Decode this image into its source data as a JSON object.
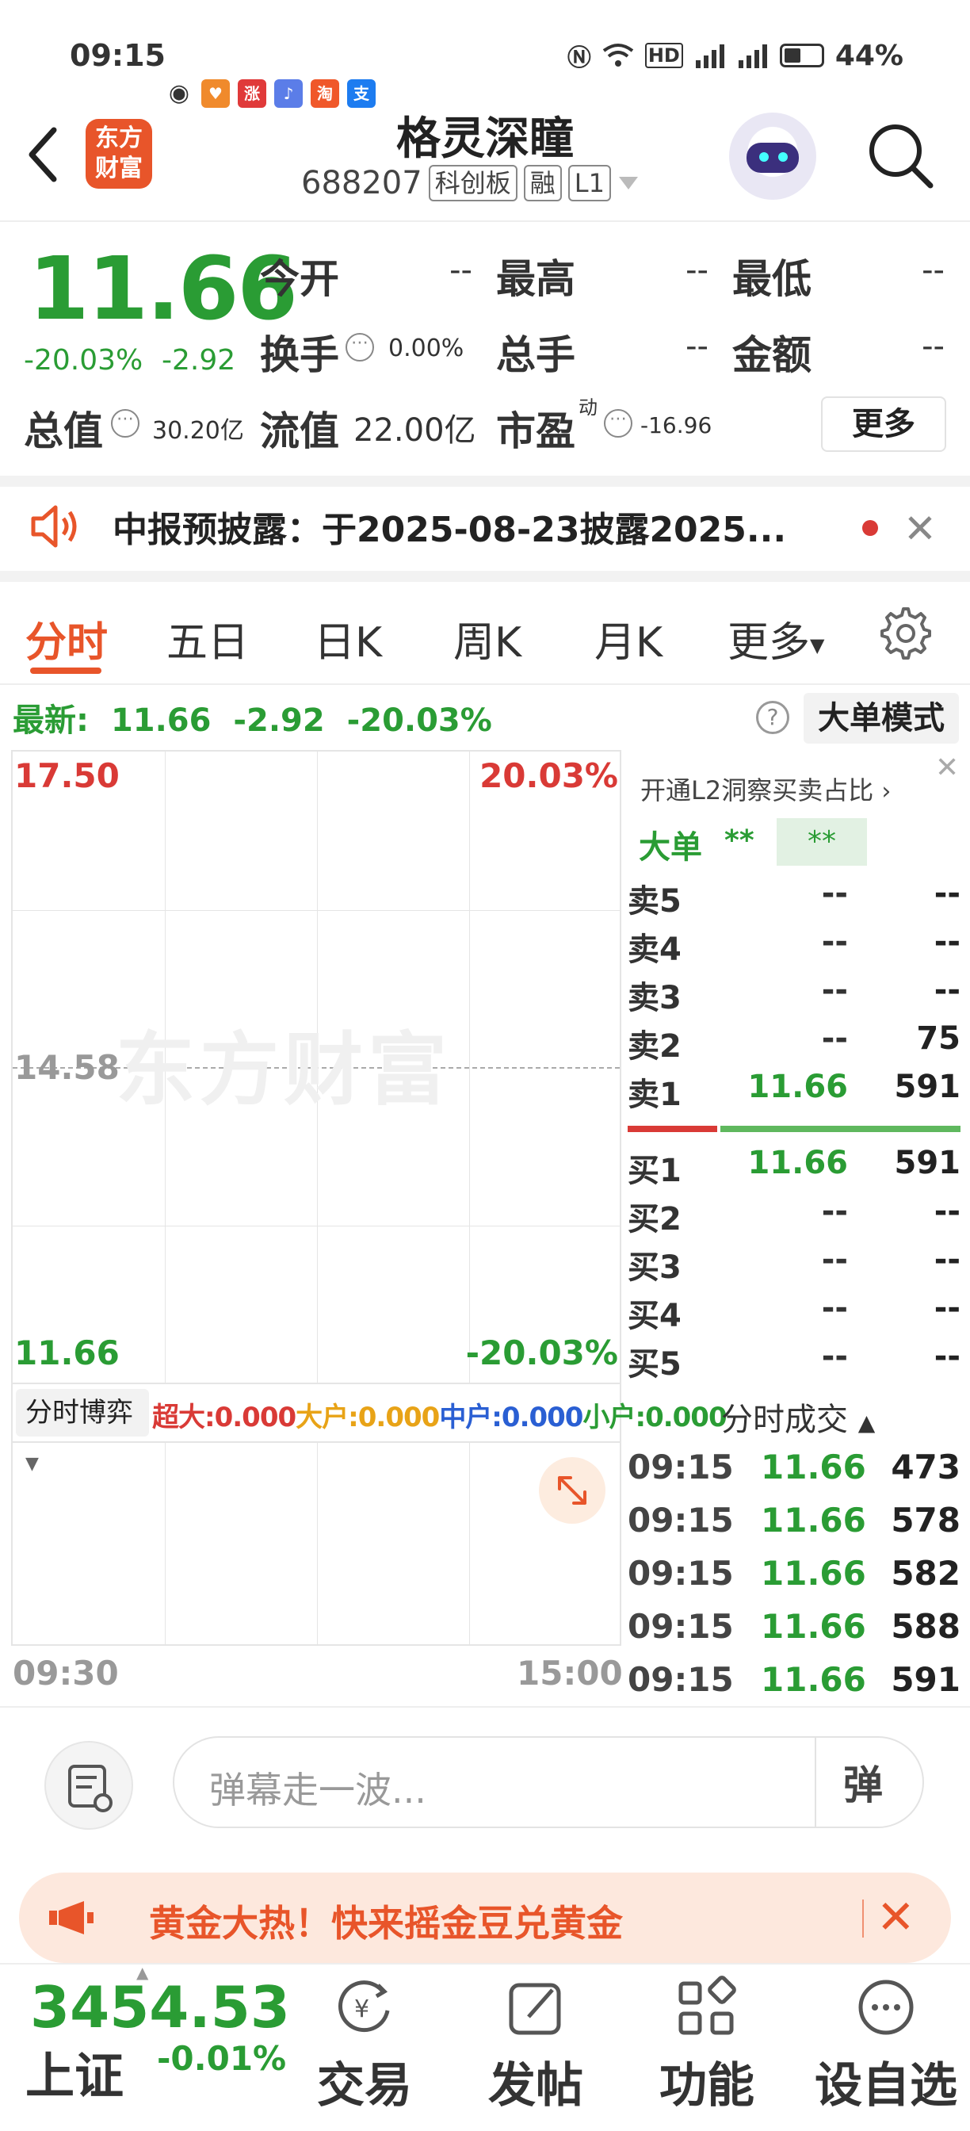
{
  "status_bar": {
    "time": "09:15",
    "battery": "44%",
    "apps": [
      {
        "name": "eye-icon",
        "color": "#333333",
        "glyph": "◉"
      },
      {
        "name": "taobao-heart-icon",
        "color": "#f08a2c",
        "glyph": "♥"
      },
      {
        "name": "zhang-app-icon",
        "color": "#e03a3a",
        "glyph": "涨"
      },
      {
        "name": "music-app-icon",
        "color": "#5b7de8",
        "glyph": "♪"
      },
      {
        "name": "taobao-app-icon",
        "color": "#f0582a",
        "glyph": "淘"
      },
      {
        "name": "alipay-app-icon",
        "color": "#1d7cf0",
        "glyph": "支"
      }
    ]
  },
  "header": {
    "logo_text_line1": "东方",
    "logo_text_line2": "财富",
    "stock_name": "格灵深瞳",
    "stock_code": "688207",
    "board_tag": "科创板",
    "margin_tag": "融",
    "level_tag": "L1"
  },
  "quote": {
    "price": "11.66",
    "change_pct": "-20.03%",
    "change": "-2.92",
    "open_label": "今开",
    "open_value": "--",
    "high_label": "最高",
    "high_value": "--",
    "low_label": "最低",
    "low_value": "--",
    "turnover_label": "换手",
    "turnover_value": "0.00%",
    "volume_label": "总手",
    "volume_value": "--",
    "amount_label": "金额",
    "amount_value": "--",
    "mktcap_label": "总值",
    "mktcap_value": "30.20亿",
    "float_label": "流值",
    "float_value": "22.00亿",
    "pe_label": "市盈",
    "pe_superscript": "动",
    "pe_value": "-16.96",
    "more_label": "更多"
  },
  "notice": {
    "text": "中报预披露：于2025-08-23披露2025..."
  },
  "tabs": {
    "items": [
      "分时",
      "五日",
      "日K",
      "周K",
      "月K",
      "更多"
    ],
    "active": 0
  },
  "latest": {
    "label": "最新:",
    "price": "11.66",
    "change": "-2.92",
    "pct": "-20.03%",
    "mode_button": "大单模式"
  },
  "chart": {
    "watermark": "东方财富",
    "top_price": "17.50",
    "top_pct": "20.03%",
    "mid_price": "14.58",
    "bottom_price": "11.66",
    "bottom_pct": "-20.03%",
    "time_start": "09:30",
    "time_end": "15:00"
  },
  "game_bar": {
    "selector": "分时博弈",
    "super_large": "超大:0.000",
    "large": "大户:0.000",
    "medium": "中户:0.000",
    "small": "小户:0.000",
    "colors": {
      "super_large": "#d93a36",
      "large": "#e8a317",
      "medium": "#2a5fd3",
      "small": "#2a9c34"
    }
  },
  "order_book": {
    "l2_prompt": "开通L2洞察买卖占比",
    "big_order_label": "大单",
    "big_order_buy": "**",
    "big_order_sell": "**",
    "asks": [
      {
        "label": "卖5",
        "price": "--",
        "vol": "--"
      },
      {
        "label": "卖4",
        "price": "--",
        "vol": "--"
      },
      {
        "label": "卖3",
        "price": "--",
        "vol": "--"
      },
      {
        "label": "卖2",
        "price": "--",
        "vol": "75"
      },
      {
        "label": "卖1",
        "price": "11.66",
        "vol": "591"
      }
    ],
    "bids": [
      {
        "label": "买1",
        "price": "11.66",
        "vol": "591"
      },
      {
        "label": "买2",
        "price": "--",
        "vol": "--"
      },
      {
        "label": "买3",
        "price": "--",
        "vol": "--"
      },
      {
        "label": "买4",
        "price": "--",
        "vol": "--"
      },
      {
        "label": "买5",
        "price": "--",
        "vol": "--"
      }
    ],
    "bid_ask_ratio_red": 0.27
  },
  "ticks": {
    "header": "分时成交",
    "rows": [
      {
        "time": "09:15",
        "price": "11.66",
        "vol": "473"
      },
      {
        "time": "09:15",
        "price": "11.66",
        "vol": "578"
      },
      {
        "time": "09:15",
        "price": "11.66",
        "vol": "582"
      },
      {
        "time": "09:15",
        "price": "11.66",
        "vol": "588"
      },
      {
        "time": "09:15",
        "price": "11.66",
        "vol": "591"
      }
    ]
  },
  "danmaku": {
    "placeholder": "弹幕走一波...",
    "send_label": "弹"
  },
  "promo": {
    "text": "黄金大热！快来摇金豆兑黄金"
  },
  "bottom_nav": {
    "index_value": "3454.53",
    "index_name": "上证",
    "index_change": "-0.01%",
    "items": [
      {
        "label": "交易",
        "icon": "trade-icon"
      },
      {
        "label": "发帖",
        "icon": "post-icon"
      },
      {
        "label": "功能",
        "icon": "functions-icon"
      },
      {
        "label": "设自选",
        "icon": "watchlist-icon"
      }
    ]
  }
}
